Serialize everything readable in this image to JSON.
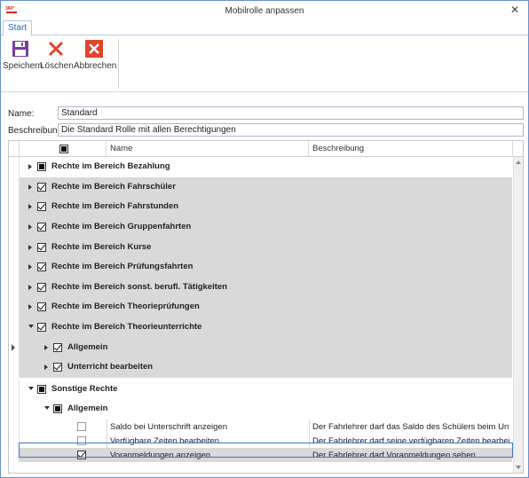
{
  "window": {
    "title": "Mobilrolle anpassen",
    "close_glyph": "✕",
    "app_icon": "app-logo-icon"
  },
  "tabs": [
    {
      "label": "Start",
      "active": true
    }
  ],
  "ribbon": {
    "save_label": "Speichern",
    "delete_label": "Löschen",
    "cancel_label": "Abbrechen",
    "save_icon": "floppy-disk-icon",
    "delete_icon": "red-x-icon",
    "cancel_icon": "cancel-box-icon"
  },
  "form": {
    "name_label": "Name:",
    "name_value": "Standard",
    "desc_label": "Beschreibung",
    "desc_value": "Die Standard Rolle mit allen Berechtigungen"
  },
  "grid": {
    "columns": [
      "Name",
      "Beschreibung"
    ],
    "groups": [
      {
        "label": "Rechte im Bereich Bezahlung",
        "state": "indeterminate",
        "expanded": false,
        "shaded": false
      },
      {
        "label": "Rechte im Bereich Fahrschüler",
        "state": "checked",
        "expanded": false,
        "shaded": true
      },
      {
        "label": "Rechte im Bereich Fahrstunden",
        "state": "checked",
        "expanded": false,
        "shaded": true
      },
      {
        "label": "Rechte im Bereich Gruppenfahrten",
        "state": "checked",
        "expanded": false,
        "shaded": true
      },
      {
        "label": "Rechte im Bereich Kurse",
        "state": "checked",
        "expanded": false,
        "shaded": true
      },
      {
        "label": "Rechte im Bereich Prüfungsfahrten",
        "state": "checked",
        "expanded": false,
        "shaded": true
      },
      {
        "label": "Rechte im Bereich sonst. berufl. Tätigkeiten",
        "state": "checked",
        "expanded": false,
        "shaded": true
      },
      {
        "label": "Rechte im Bereich Theorieprüfungen",
        "state": "checked",
        "expanded": false,
        "shaded": true
      },
      {
        "label": "Rechte im Bereich Theorieunterrichte",
        "state": "checked",
        "expanded": true,
        "shaded": true
      }
    ],
    "theorie_sub": [
      {
        "label": "Allgemein",
        "state": "checked"
      },
      {
        "label": "Unterricht bearbeiten",
        "state": "checked"
      }
    ],
    "sonstige": {
      "label": "Sonstige Rechte",
      "state": "indeterminate"
    },
    "sonstige_sub": {
      "label": "Allgemein",
      "state": "indeterminate"
    },
    "items": [
      {
        "name": "Saldo bei Unterschrift anzeigen",
        "desc": "Der Fahrlehrer darf das Saldo des Schülers beim Unter...",
        "checked": false
      },
      {
        "name": "Verfügbare Zeiten bearbeiten",
        "desc": "Der Fahrlehrer darf seine verfügbaren Zeiten bearbeiten",
        "checked": false
      },
      {
        "name": "Voranmeldungen anzeigen",
        "desc": "Der Fahrlehrer darf Voranmeldungen sehen",
        "checked": true
      }
    ]
  }
}
